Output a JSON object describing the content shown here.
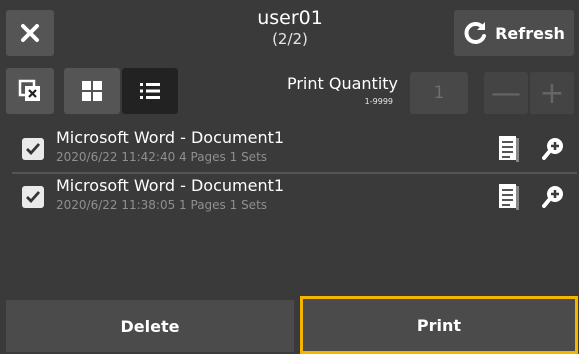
{
  "header": {
    "title": "user01",
    "subtitle": "(2/2)",
    "refresh_label": "Refresh"
  },
  "toolbar": {
    "print_quantity_label": "Print Quantity",
    "print_quantity_range": "1-9999",
    "quantity_value": "1",
    "minus_label": "—",
    "plus_label": "+"
  },
  "documents": [
    {
      "name": "Microsoft Word - Document1",
      "meta": "2020/6/22 11:42:40  4 Pages  1 Sets",
      "checked": true
    },
    {
      "name": "Microsoft Word - Document1",
      "meta": "2020/6/22 11:38:05  1 Pages  1 Sets",
      "checked": true
    }
  ],
  "footer": {
    "delete_label": "Delete",
    "print_label": "Print"
  },
  "colors": {
    "accent": "#f5b400",
    "background": "#3a3a3a"
  }
}
